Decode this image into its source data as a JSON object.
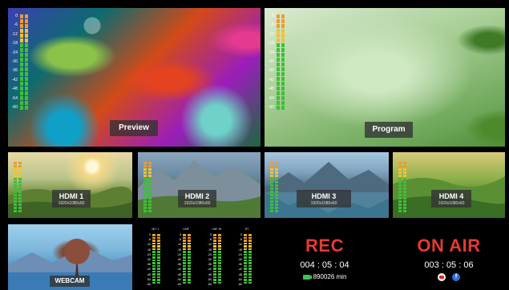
{
  "colors": {
    "meter_yellow": "#f2c230",
    "meter_orange": "#f39a2b",
    "meter_green": "#3fbf3a",
    "rec_red": "#e23b32",
    "label_bg": "#3a3a3a"
  },
  "meter_scale": [
    "0",
    "-6",
    "-12",
    "-18",
    "-24",
    "-30",
    "-36",
    "-42",
    "-48",
    "-54",
    "-60"
  ],
  "preview": {
    "label": "Preview"
  },
  "program": {
    "label": "Program"
  },
  "hdmi": [
    {
      "label": "HDMI 1",
      "resolution": "1920x1080x60"
    },
    {
      "label": "HDMI 2",
      "resolution": "1920x1080x60"
    },
    {
      "label": "HDMI 3",
      "resolution": "1920x1080x60"
    },
    {
      "label": "HDMI 4",
      "resolution": "1920x1080x60"
    }
  ],
  "webcam": {
    "label": "WEBCAM"
  },
  "audio_channels": [
    {
      "name": "MIC 1"
    },
    {
      "name": "LINE"
    },
    {
      "name": "LINE IN"
    },
    {
      "name": "BT"
    }
  ],
  "rec": {
    "title": "REC",
    "time": "004 : 05 : 04",
    "storage": "890026 min",
    "storage_icon": "sd-card-icon"
  },
  "on_air": {
    "title": "ON AIR",
    "time": "003 : 05 : 06",
    "platform_icons": [
      "youtube-icon",
      "facebook-icon"
    ],
    "facebook_glyph": "f"
  }
}
